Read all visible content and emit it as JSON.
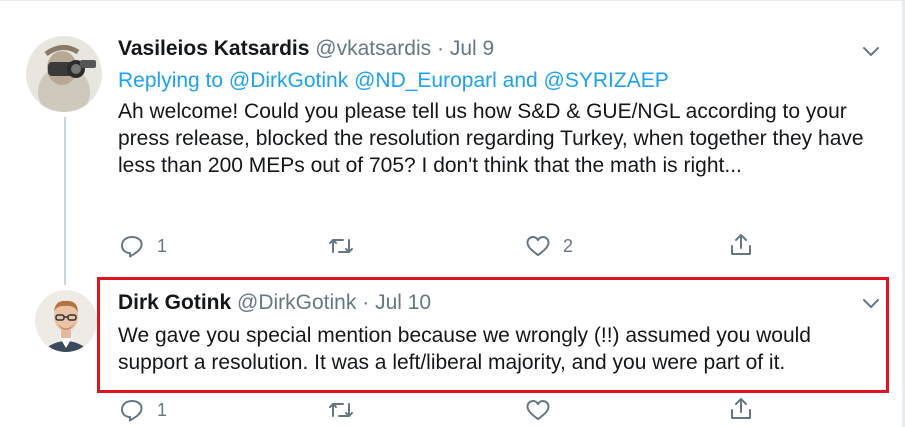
{
  "tweet1": {
    "author_name": "Vasileios Katsardis",
    "handle": "@vkatsardis",
    "separator": "·",
    "date": "Jul 9",
    "replying_prefix": "Replying to",
    "mentions": [
      "@DirkGotink",
      "@ND_Europarl",
      "@SYRIZAEP"
    ],
    "mention_conjunction": "and",
    "body": "Ah welcome! Could you please tell us how S&D & GUE/NGL according to your press release, blocked the resolution regarding Turkey, when together they have less than 200 MEPs out of 705? I don't think that the math is right...",
    "reply_count": "1",
    "retweet_count": "",
    "like_count": "2"
  },
  "tweet2": {
    "author_name": "Dirk Gotink",
    "handle": "@DirkGotink",
    "separator": "·",
    "date": "Jul 10",
    "body": "We gave you special mention because we wrongly (!!) assumed you would support a resolution. It was a left/liberal majority, and you were part of it.",
    "reply_count": "1",
    "retweet_count": "",
    "like_count": ""
  },
  "icons": {
    "reply": "reply-icon",
    "retweet": "retweet-icon",
    "like": "heart-icon",
    "share": "share-icon",
    "more": "chevron-down-icon"
  },
  "colors": {
    "link": "#1da1f2",
    "muted": "#657786",
    "text": "#14171a",
    "highlight": "#e0141e"
  }
}
